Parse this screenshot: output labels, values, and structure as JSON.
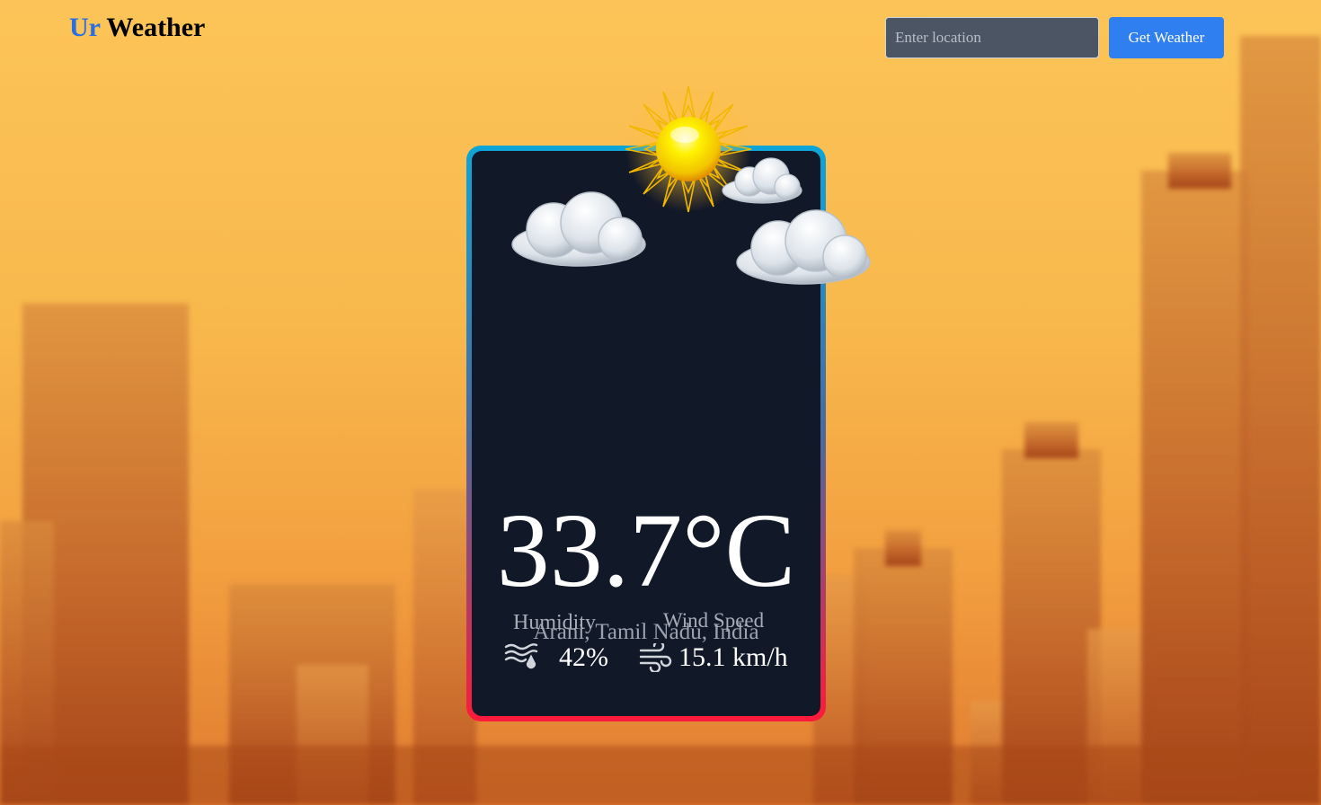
{
  "app": {
    "brand_prefix": "Ur",
    "brand_suffix": " Weather"
  },
  "search": {
    "placeholder": "Enter location",
    "value": "",
    "button_label": "Get Weather"
  },
  "weather": {
    "temperature": "33.7°C",
    "location": "Arani, Tamil Nadu, India",
    "humidity_label": "Humidity",
    "humidity_value": "42%",
    "wind_label": "Wind Speed",
    "wind_value": "15.1 km/h",
    "condition_icons": [
      "sun-icon",
      "cloud-icon"
    ]
  },
  "colors": {
    "brand_accent": "#2a6ee6",
    "button": "#2f7ff0",
    "card_bg": "#111827",
    "card_border_top": "#0ea5d8",
    "card_border_bottom": "#ff1a3a",
    "background": "#f8b84c"
  }
}
